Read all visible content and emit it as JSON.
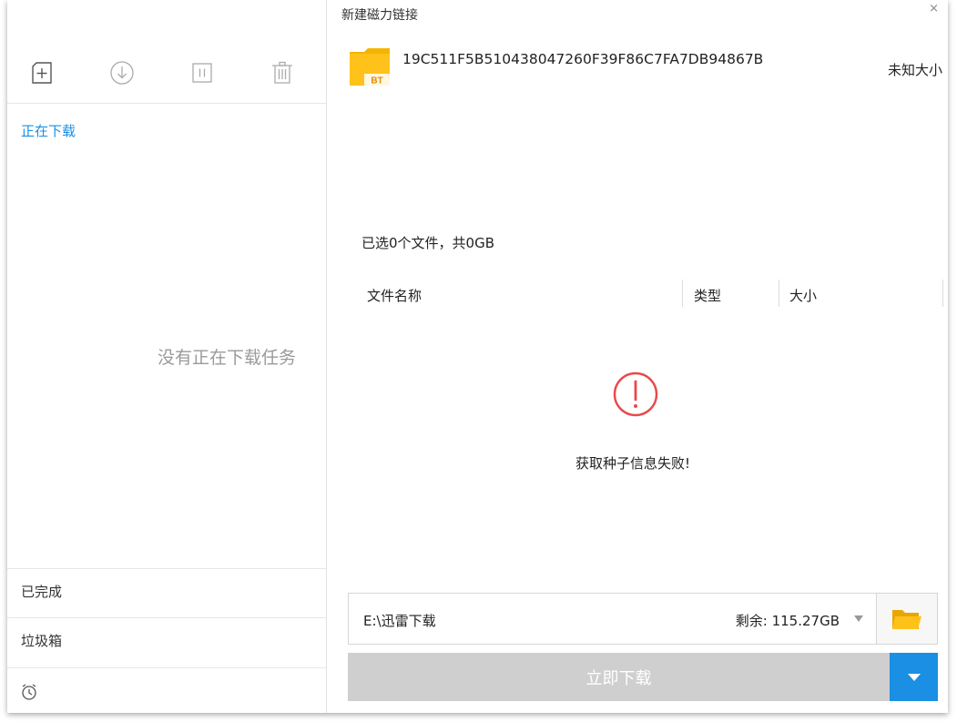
{
  "left": {
    "toolbar": {
      "new_icon": "add-task-icon",
      "download_icon": "download-icon",
      "pause_icon": "pause-icon",
      "delete_icon": "trash-icon"
    },
    "section_downloading": "正在下载",
    "empty_message": "没有正在下载任务",
    "nav_completed": "已完成",
    "nav_trash": "垃圾箱",
    "clock_icon": "alarm-clock-icon"
  },
  "dialog": {
    "title": "新建磁力链接",
    "close": "×",
    "torrent": {
      "badge": "BT",
      "hash": "19C511F5B510438047260F39F86C7FA7DB94867B",
      "size": "未知大小"
    },
    "selected_info": "已选0个文件，共0GB",
    "columns": {
      "name": "文件名称",
      "type": "类型",
      "size": "大小"
    },
    "error_message": "获取种子信息失败!",
    "save_path": "E:\\迅雷下载",
    "free_space": "剩余: 115.27GB",
    "download_button": "立即下载"
  },
  "colors": {
    "accent": "#1a8fe3",
    "error": "#e84a4a",
    "folder": "#f5b400"
  }
}
